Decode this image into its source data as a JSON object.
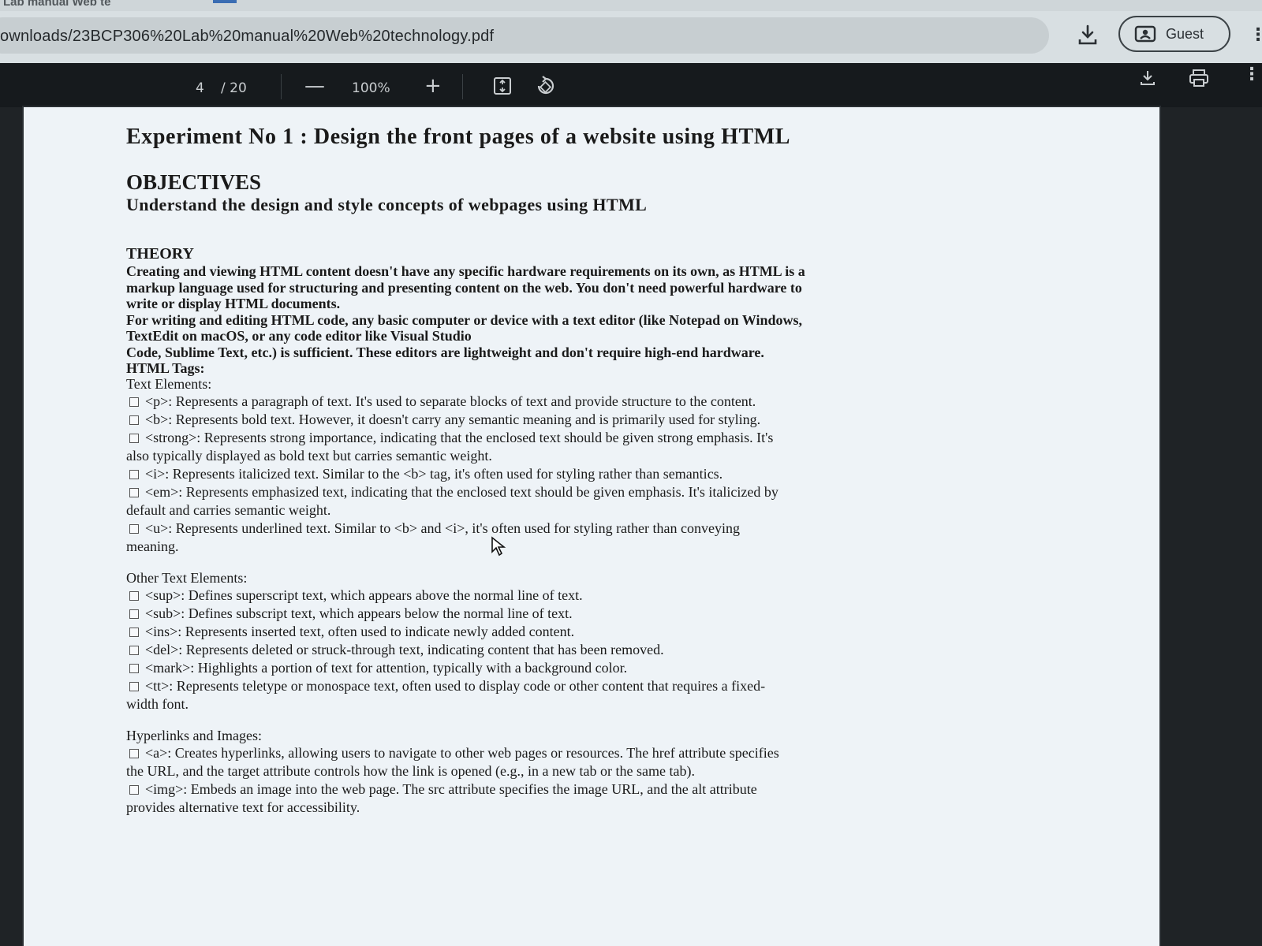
{
  "browser": {
    "tab_title": "Lab manual Web te",
    "url": "ownloads/23BCP306%20Lab%20manual%20Web%20technology.pdf",
    "profile_label": "Guest",
    "icons": [
      "download-icon",
      "profile-icon",
      "menu-icon"
    ]
  },
  "pdf_toolbar": {
    "page_current": "4",
    "page_total": "/ 20",
    "zoom_out_label": "—",
    "zoom": "100%",
    "zoom_in_label": "+",
    "icons": [
      "fit-page-icon",
      "rotate-icon",
      "download-icon",
      "print-icon",
      "more-icon"
    ]
  },
  "document": {
    "title": "Experiment No 1 :  Design the front pages of a website using HTML",
    "objectives_heading": "OBJECTIVES",
    "objectives_text": "Understand the design and style concepts of webpages using HTML",
    "theory_heading": "THEORY",
    "theory_lines": [
      "Creating and viewing HTML content doesn't have any specific hardware requirements on its own, as HTML is a",
      "markup language used for structuring and presenting content on the web. You don't need powerful hardware to",
      "write or display HTML documents.",
      "For writing and editing HTML code, any basic computer or device with a text editor (like Notepad on Windows,",
      "TextEdit on macOS, or any code editor like Visual Studio",
      " Code, Sublime Text, etc.) is sufficient. These editors are lightweight and don't require high-end hardware."
    ],
    "tags_heading": "HTML Tags:",
    "text_elements_heading": "Text Elements:",
    "text_elements": [
      "<p>: Represents a paragraph of text. It's used to separate blocks of text and provide structure to the content.",
      "<b>: Represents bold text. However, it doesn't carry any semantic meaning and is primarily used for styling.",
      "<strong>: Represents strong importance, indicating that the enclosed text should be given strong emphasis. It's",
      "also typically displayed as bold text but carries semantic weight.",
      "<i>: Represents italicized text. Similar to the <b> tag, it's often used for styling rather than semantics.",
      "<em>: Represents emphasized text, indicating that the enclosed text should be given emphasis. It's italicized by",
      "default and carries semantic weight.",
      "<u>: Represents underlined text. Similar to <b> and <i>, it's often used for styling rather than conveying",
      "meaning."
    ],
    "other_heading": "Other Text Elements:",
    "other_elements": [
      "<sup>: Defines superscript text, which appears above the normal line of text.",
      "<sub>: Defines subscript text, which appears below the normal line of text.",
      "<ins>: Represents inserted text, often used to indicate newly added content.",
      "<del>: Represents deleted or struck-through text, indicating content that has been removed.",
      "<mark>: Highlights a portion of text for attention, typically with a background color.",
      "<tt>: Represents teletype or monospace text, often used to display code or other content that requires a fixed-",
      "width font."
    ],
    "links_heading": "Hyperlinks and Images:",
    "link_elements": [
      "<a>: Creates hyperlinks, allowing users to navigate to other web pages or resources. The href attribute specifies",
      "the URL, and the target attribute controls how the link is opened (e.g., in a new tab or the same tab).",
      "<img>: Embeds an image into the web page. The src attribute specifies the image URL, and the alt attribute",
      "provides alternative text for accessibility."
    ]
  },
  "colors": {
    "chrome_bg": "#d8dfe2",
    "viewer_bg": "#161a1d",
    "page_bg": "#eef3f7",
    "text": "#1a1a1a"
  }
}
